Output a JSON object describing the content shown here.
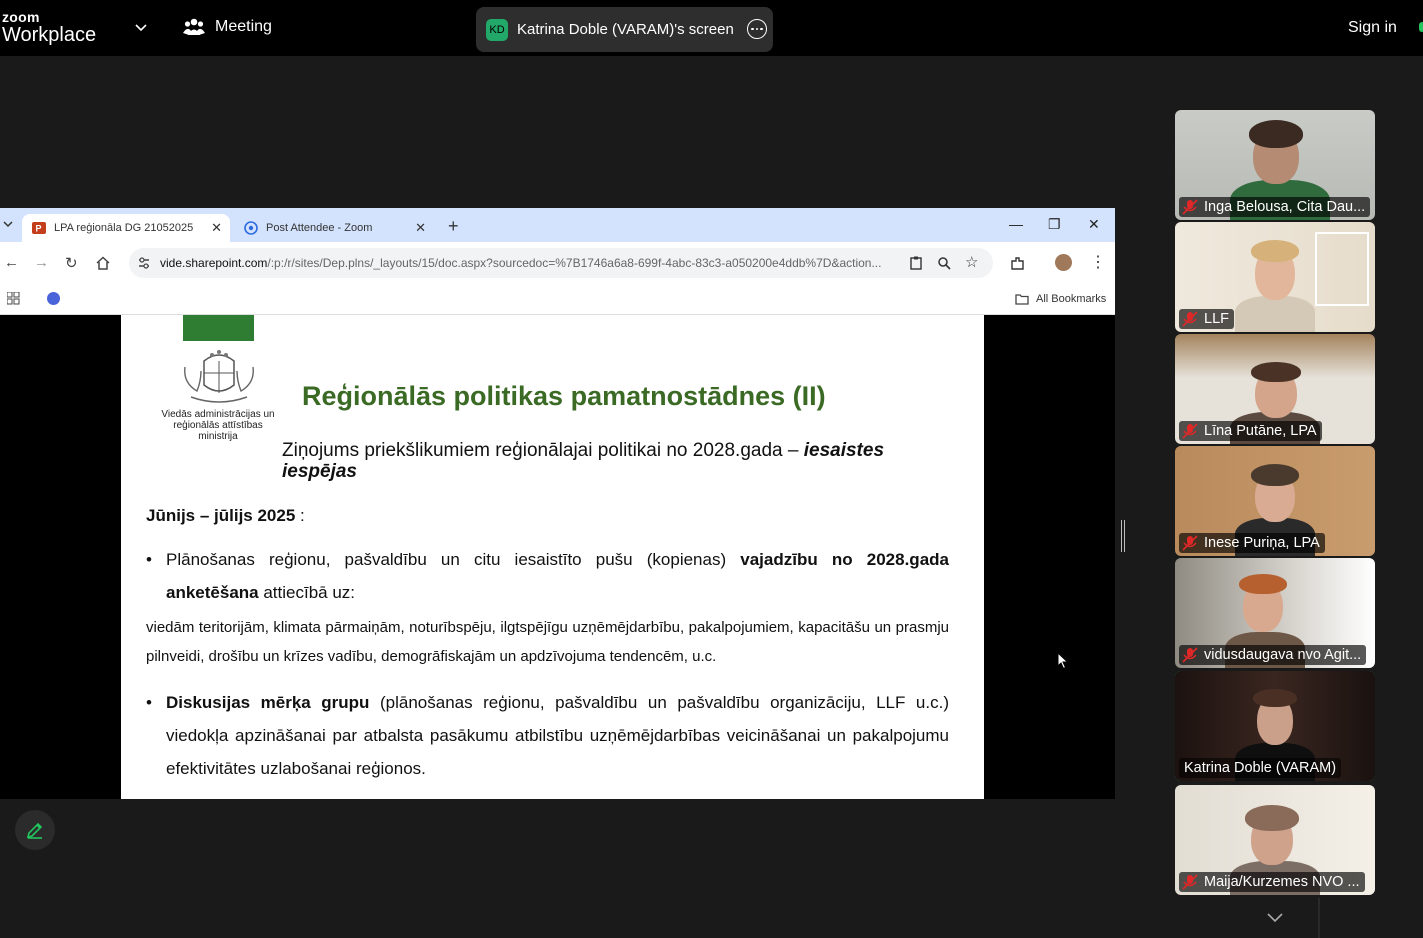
{
  "app": {
    "logo_top": "zoom",
    "logo_bottom": "Workplace",
    "meeting_label": "Meeting",
    "share_initials": "KD",
    "share_title": "Katrina Doble (VARAM)'s screen",
    "sign_in": "Sign in",
    "accent_color": "#22c55e"
  },
  "browser": {
    "tabs": [
      {
        "label": "LPA reģionāla DG 21052025",
        "icon": "powerpoint-icon",
        "active": true
      },
      {
        "label": "Post Attendee - Zoom",
        "icon": "zoom-icon",
        "active": false
      }
    ],
    "url_host": "vide.sharepoint.com",
    "url_path": "/:p:/r/sites/Dep.plns/_layouts/15/doc.aspx?sourcedoc=%7B1746a6a8-699f-4abc-83c3-a050200e4ddb%7D&action...",
    "bookmarks_label": "All Bookmarks"
  },
  "slide": {
    "ministry": "Viedās administrācijas un reģionālās attīstības ministrija",
    "title": "Reģionālās politikas pamatnostādnes (II)",
    "subtitle_plain": "Ziņojums priekšlikumiem reģionālajai politikai no 2028.gada – ",
    "subtitle_em": "iesaistes iespējas",
    "period_bold": "Jūnijs – jūlijs 2025",
    "period_rest": " :",
    "bullet1_plain": "Plānošanas reģionu, pašvaldību un citu iesaistīto pušu (kopienas) ",
    "bullet1_bold": "vajadzību no 2028.gada anketēšana",
    "bullet1_rest": " attiecībā uz:",
    "para": "viedām teritorijām, klimata pārmaiņām, noturībspēju, ilgtspējīgu uzņēmējdarbību, pakalpojumiem, kapacitāšu un prasmju pilnveidi, drošību un krīzes vadību, demogrāfiskajām un apdzīvojuma tendencēm, u.c.",
    "bullet2_bold": "Diskusijas mērķa grupu",
    "bullet2_rest": " (plānošanas reģionu, pašvaldību un pašvaldību organizāciju, LLF u.c.) viedokļa apzināšanai par atbalsta pasākumu atbilstību uzņēmējdarbības veicināšanai un pakalpojumu efektivitātes uzlabošanai reģionos."
  },
  "participants": [
    {
      "name": "Inga Belousa, Cita Dau...",
      "muted": true,
      "speaking": false
    },
    {
      "name": "LLF",
      "muted": true,
      "speaking": false
    },
    {
      "name": "Līna Putāne, LPA",
      "muted": true,
      "speaking": false
    },
    {
      "name": "Inese Puriņa, LPA",
      "muted": true,
      "speaking": false
    },
    {
      "name": "vidusdaugava nvo Agit...",
      "muted": true,
      "speaking": false
    },
    {
      "name": "Katrina Doble (VARAM)",
      "muted": false,
      "speaking": true
    },
    {
      "name": "Maija/Kurzemes NVO ...",
      "muted": true,
      "speaking": false
    }
  ]
}
